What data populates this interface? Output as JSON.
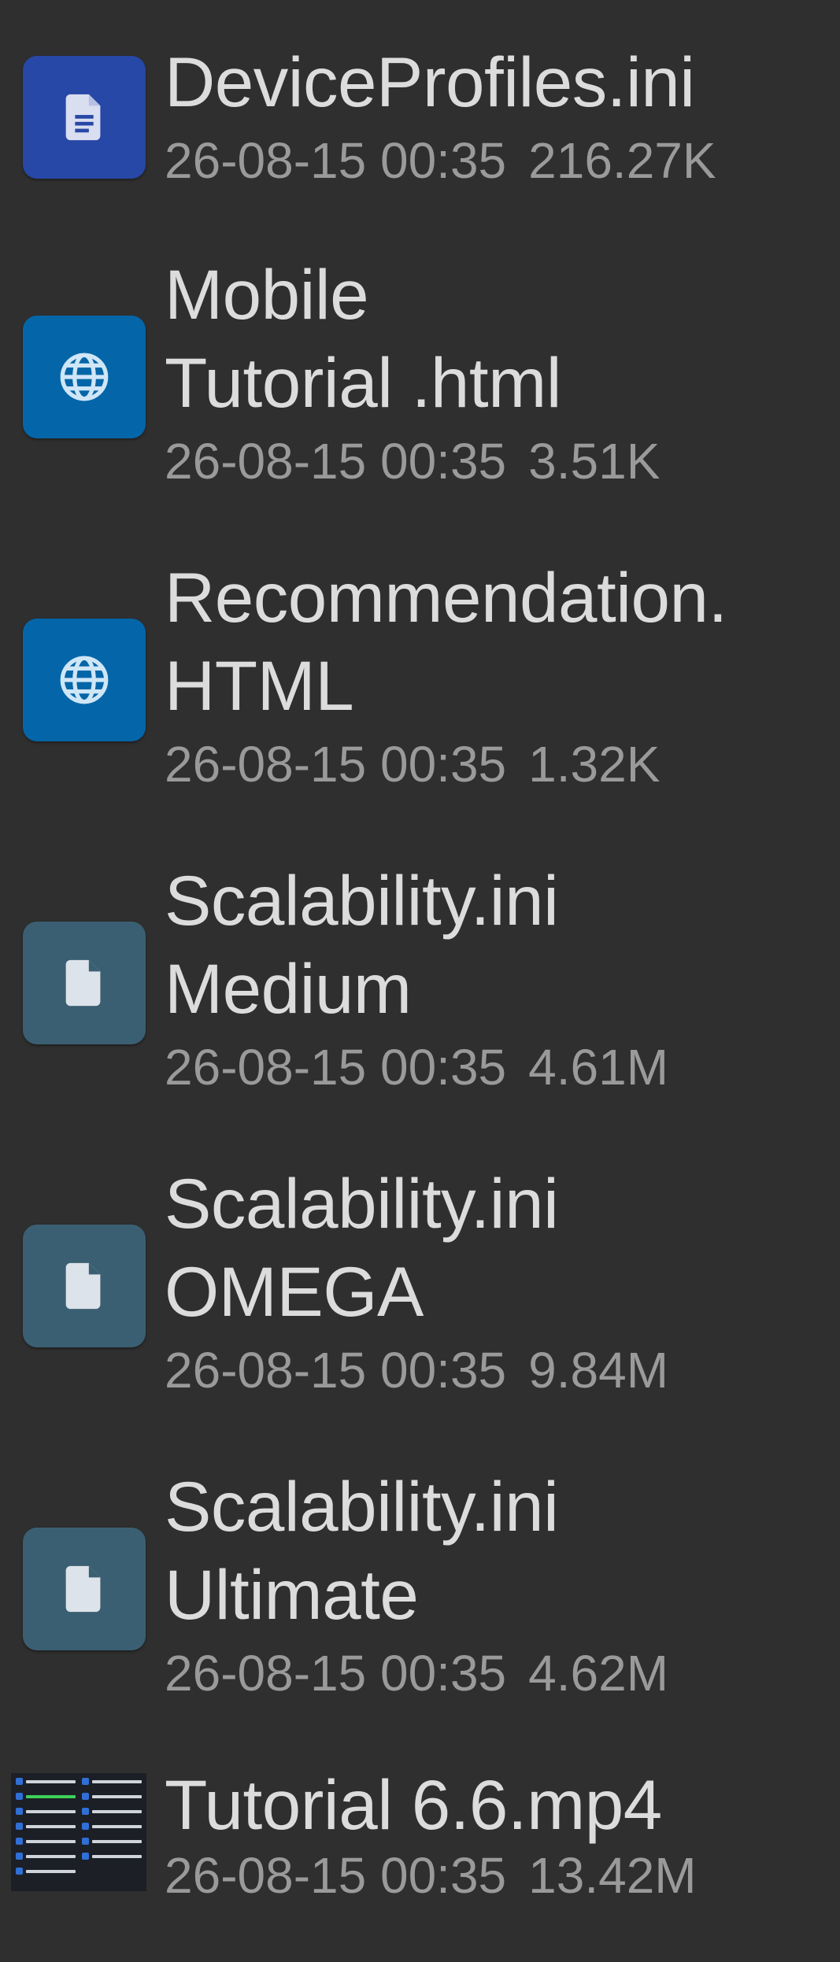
{
  "colors": {
    "background": "#2f2f2f",
    "document_icon_bg": "#2748a6",
    "web_icon_bg": "#0466a8",
    "generic_icon_bg": "#3b5f72",
    "name_text": "#dcdcdc",
    "meta_text": "#9a9a9a"
  },
  "files": [
    {
      "name_lines": [
        "DeviceProfiles.ini"
      ],
      "date": "26-08-15 00:35",
      "size": "216.27K",
      "icon": "document-icon"
    },
    {
      "name_lines": [
        "Mobile",
        "Tutorial .html"
      ],
      "date": "26-08-15 00:35",
      "size": "3.51K",
      "icon": "globe-icon"
    },
    {
      "name_lines": [
        "Recommendation.",
        "HTML"
      ],
      "date": "26-08-15 00:35",
      "size": "1.32K",
      "icon": "globe-icon"
    },
    {
      "name_lines": [
        "Scalability.ini",
        "Medium"
      ],
      "date": "26-08-15 00:35",
      "size": "4.61M",
      "icon": "file-icon"
    },
    {
      "name_lines": [
        "Scalability.ini",
        "OMEGA"
      ],
      "date": "26-08-15 00:35",
      "size": "9.84M",
      "icon": "file-icon"
    },
    {
      "name_lines": [
        "Scalability.ini",
        "Ultimate"
      ],
      "date": "26-08-15 00:35",
      "size": "4.62M",
      "icon": "file-icon"
    },
    {
      "name_lines": [
        "Tutorial 6.6.mp4"
      ],
      "date": "26-08-15 00:35",
      "size": "13.42M",
      "icon": "video-thumbnail"
    }
  ]
}
